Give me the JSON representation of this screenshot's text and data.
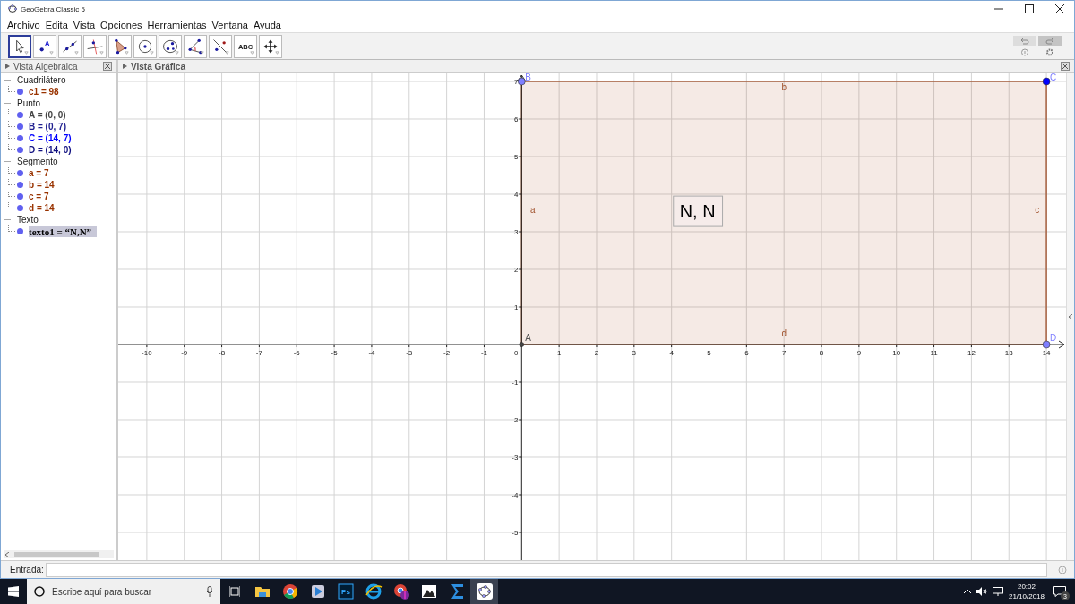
{
  "window": {
    "title": "GeoGebra Classic 5"
  },
  "menu": [
    "Archivo",
    "Edita",
    "Vista",
    "Opciones",
    "Herramientas",
    "Ventana",
    "Ayuda"
  ],
  "toolbar": {
    "tools": [
      {
        "kind": "move",
        "selected": true
      },
      {
        "kind": "point",
        "selected": false,
        "label": "A"
      },
      {
        "kind": "line",
        "selected": false
      },
      {
        "kind": "perpendicular",
        "selected": false
      },
      {
        "kind": "polygon",
        "selected": false
      },
      {
        "kind": "circle",
        "selected": false
      },
      {
        "kind": "conic",
        "selected": false
      },
      {
        "kind": "angle",
        "selected": false
      },
      {
        "kind": "reflect",
        "selected": false
      },
      {
        "kind": "text",
        "selected": false,
        "label": "ABC"
      },
      {
        "kind": "move_view",
        "selected": false
      }
    ]
  },
  "algebra": {
    "title": "Vista Algebraica",
    "groups": [
      {
        "name": "Cuadrilátero",
        "expanded": true,
        "items": [
          {
            "text": "c1 = 98",
            "color": "#993300",
            "kind": "value",
            "selected": false
          }
        ]
      },
      {
        "name": "Punto",
        "expanded": true,
        "items": [
          {
            "text": "A = (0, 0)",
            "color": "#444444",
            "kind": "value",
            "selected": false
          },
          {
            "text": "B = (0, 7)",
            "color": "#202090",
            "kind": "value",
            "selected": false
          },
          {
            "text": "C = (14, 7)",
            "color": "#0000ff",
            "kind": "value",
            "selected": false
          },
          {
            "text": "D = (14, 0)",
            "color": "#101080",
            "kind": "value",
            "selected": false
          }
        ]
      },
      {
        "name": "Segmento",
        "expanded": true,
        "items": [
          {
            "text": "a = 7",
            "color": "#993300",
            "kind": "value",
            "selected": false
          },
          {
            "text": "b = 14",
            "color": "#993300",
            "kind": "value",
            "selected": false
          },
          {
            "text": "c = 7",
            "color": "#993300",
            "kind": "value",
            "selected": false
          },
          {
            "text": "d = 14",
            "color": "#993300",
            "kind": "value",
            "selected": false
          }
        ]
      },
      {
        "name": "Texto",
        "expanded": true,
        "items": [
          {
            "text": "texto1 = “N,N”",
            "color": "#000000",
            "kind": "text",
            "selected": true
          }
        ]
      }
    ]
  },
  "graphics": {
    "title": "Vista Gráfica",
    "x_ticks": [
      "-10",
      "-9",
      "-8",
      "-7",
      "-6",
      "-5",
      "-4",
      "-3",
      "-2",
      "-1",
      "0",
      "1",
      "2",
      "3",
      "4",
      "5",
      "6",
      "7",
      "8",
      "9",
      "10",
      "11",
      "12",
      "13",
      "14"
    ],
    "y_ticks": [
      "7",
      "6",
      "5",
      "4",
      "3",
      "2",
      "1",
      "-1",
      "-2",
      "-3",
      "-4",
      "-5"
    ],
    "points": [
      {
        "label": "B",
        "color": "#7f7fff"
      },
      {
        "label": "C",
        "color": "#0000ff"
      },
      {
        "label": "A",
        "color": "#444444"
      },
      {
        "label": "D",
        "color": "#7f7fff"
      }
    ],
    "segments": [
      "a",
      "b",
      "c",
      "d"
    ],
    "text_object": "N, N"
  },
  "input": {
    "label": "Entrada:"
  },
  "taskbar": {
    "search_placeholder": "Escribe aquí para buscar",
    "apps": [
      {
        "kind": "folder",
        "selected": false
      },
      {
        "kind": "chrome",
        "selected": false
      },
      {
        "kind": "player",
        "selected": false
      },
      {
        "kind": "photoshop",
        "label": "Ps",
        "selected": false
      },
      {
        "kind": "ie",
        "selected": false
      },
      {
        "kind": "chrome-app",
        "selected": false
      },
      {
        "kind": "photos",
        "selected": false
      },
      {
        "kind": "sigma",
        "selected": false
      },
      {
        "kind": "geogebra",
        "selected": true
      }
    ],
    "time": "20:02",
    "date": "21/10/2018",
    "notifications": "3"
  }
}
